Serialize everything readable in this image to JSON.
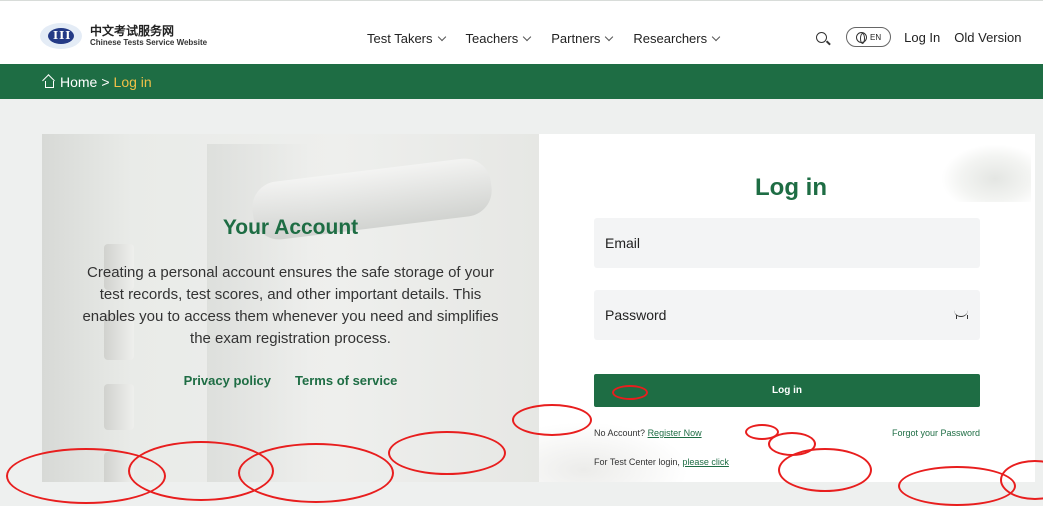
{
  "header": {
    "logo_cn": "中文考试服务网",
    "logo_en": "Chinese Tests Service Website",
    "nav": [
      {
        "label": "Test Takers"
      },
      {
        "label": "Teachers"
      },
      {
        "label": "Partners"
      },
      {
        "label": "Researchers"
      }
    ],
    "lang_label": "EN",
    "login_label": "Log In",
    "old_version_label": "Old Version"
  },
  "breadcrumb": {
    "home": "Home",
    "separator": ">",
    "current": "Log in"
  },
  "account": {
    "title": "Your Account",
    "description": "Creating a personal account ensures the safe storage of your test records, test scores, and other important details. This enables you to access them whenever you need and simplifies the exam registration process.",
    "privacy_label": "Privacy policy",
    "terms_label": "Terms of service"
  },
  "login_form": {
    "title": "Log in",
    "email_placeholder": "Email",
    "password_placeholder": "Password",
    "submit_label": "Log in",
    "no_account_text": "No Account?",
    "register_label": "Register Now",
    "forgot_label": "Forgot your Password",
    "test_center_text": "For Test Center login,",
    "please_click_label": "please click"
  },
  "colors": {
    "brand_green": "#1e6d44",
    "breadcrumb_highlight": "#f0c048",
    "annotation_red": "#e81e1e"
  }
}
